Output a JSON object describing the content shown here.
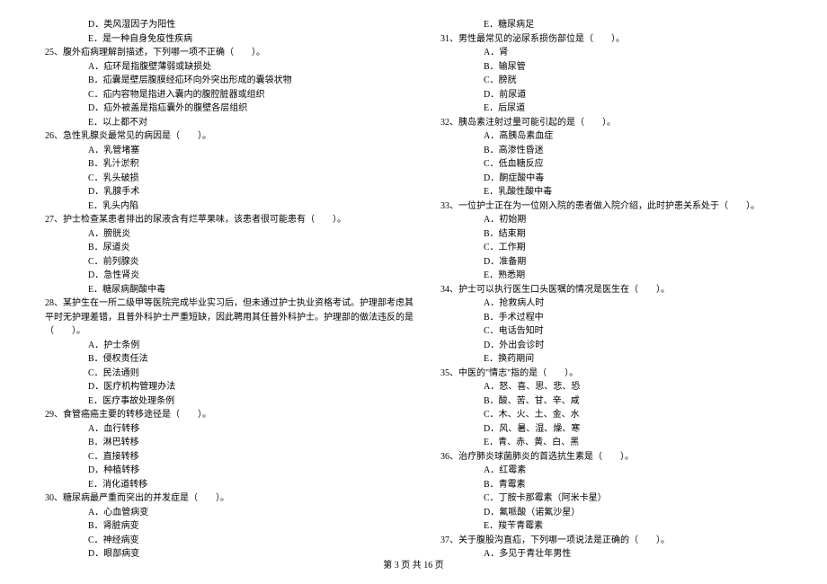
{
  "left_column": [
    {
      "cls": "option",
      "text": "D．类风湿因子为阳性"
    },
    {
      "cls": "option",
      "text": "E．是一种自身免疫性疾病"
    },
    {
      "cls": "question",
      "text": "25、腹外疝病理解剖描述，下列哪一项不正确（　　）。"
    },
    {
      "cls": "option",
      "text": "A．疝环是指腹壁薄弱或缺损处"
    },
    {
      "cls": "option",
      "text": "B．疝囊是壁层腹膜经疝环向外突出形成的囊袋状物"
    },
    {
      "cls": "option",
      "text": "C．疝内容物是指进入囊内的腹腔脏器或组织"
    },
    {
      "cls": "option",
      "text": "D．疝外被盖是指疝囊外的腹壁各层组织"
    },
    {
      "cls": "option",
      "text": "E．以上都不对"
    },
    {
      "cls": "question",
      "text": "26、急性乳腺炎最常见的病因是（　　）。"
    },
    {
      "cls": "option",
      "text": "A．乳管堵塞"
    },
    {
      "cls": "option",
      "text": "B．乳汁淤积"
    },
    {
      "cls": "option",
      "text": "C．乳头破损"
    },
    {
      "cls": "option",
      "text": "D．乳腺手术"
    },
    {
      "cls": "option",
      "text": "E．乳头内陷"
    },
    {
      "cls": "question",
      "text": "27、护士检查某患者排出的尿液含有烂苹果味，该患者很可能患有（　　）。"
    },
    {
      "cls": "option",
      "text": "A．膀胱炎"
    },
    {
      "cls": "option",
      "text": "B．尿道炎"
    },
    {
      "cls": "option",
      "text": "C．前列腺炎"
    },
    {
      "cls": "option",
      "text": "D．急性肾炎"
    },
    {
      "cls": "option",
      "text": "E．糖尿病酮酸中毒"
    },
    {
      "cls": "question",
      "text": "28、某护生在一所二级甲等医院完成毕业实习后，但未通过护士执业资格考试。护理部考虑其"
    },
    {
      "cls": "question-cont",
      "text": "平时无护理差错，且普外科护士严重短缺，因此聘用其任普外科护士。护理部的做法违反的是"
    },
    {
      "cls": "question-cont",
      "text": "（　　）。"
    },
    {
      "cls": "option",
      "text": "A．护士条例"
    },
    {
      "cls": "option",
      "text": "B．侵权责任法"
    },
    {
      "cls": "option",
      "text": "C．民法通则"
    },
    {
      "cls": "option",
      "text": "D．医疗机构管理办法"
    },
    {
      "cls": "option",
      "text": "E．医疗事故处理条例"
    },
    {
      "cls": "question",
      "text": "29、食管癌癌主要的转移途径是（　　）。"
    },
    {
      "cls": "option",
      "text": "A．血行转移"
    },
    {
      "cls": "option",
      "text": "B．淋巴转移"
    },
    {
      "cls": "option",
      "text": "C．直接转移"
    },
    {
      "cls": "option",
      "text": "D．种植转移"
    },
    {
      "cls": "option",
      "text": "E．消化道转移"
    },
    {
      "cls": "question",
      "text": "30、糖尿病最严重而突出的并发症是（　　）。"
    },
    {
      "cls": "option",
      "text": "A．心血管病变"
    },
    {
      "cls": "option",
      "text": "B．肾脏病变"
    },
    {
      "cls": "option",
      "text": "C．神经病变"
    },
    {
      "cls": "option",
      "text": "D．眼部病变"
    }
  ],
  "right_column": [
    {
      "cls": "option",
      "text": "E．糖尿病足"
    },
    {
      "cls": "question",
      "text": "31、男性最常见的泌尿系损伤部位是（　　）。"
    },
    {
      "cls": "option",
      "text": "A．肾"
    },
    {
      "cls": "option",
      "text": "B．输尿管"
    },
    {
      "cls": "option",
      "text": "C．膀胱"
    },
    {
      "cls": "option",
      "text": "D．前尿道"
    },
    {
      "cls": "option",
      "text": "E．后尿道"
    },
    {
      "cls": "question",
      "text": "32、胰岛素注射过量可能引起的是（　　）。"
    },
    {
      "cls": "option",
      "text": "A．高胰岛素血症"
    },
    {
      "cls": "option",
      "text": "B．高渗性昏迷"
    },
    {
      "cls": "option",
      "text": "C．低血糖反应"
    },
    {
      "cls": "option",
      "text": "D．酮症酸中毒"
    },
    {
      "cls": "option",
      "text": "E．乳酸性酸中毒"
    },
    {
      "cls": "question",
      "text": "33、一位护士正在为一位刚入院的患者做入院介绍，此时护患关系处于（　　）。"
    },
    {
      "cls": "option",
      "text": "A．初始期"
    },
    {
      "cls": "option",
      "text": "B．结束期"
    },
    {
      "cls": "option",
      "text": "C．工作期"
    },
    {
      "cls": "option",
      "text": "D．准备期"
    },
    {
      "cls": "option",
      "text": "E．熟悉期"
    },
    {
      "cls": "question",
      "text": "34、护士可以执行医生口头医嘱的情况是医生在（　　）。"
    },
    {
      "cls": "option",
      "text": "A．抢救病人时"
    },
    {
      "cls": "option",
      "text": "B．手术过程中"
    },
    {
      "cls": "option",
      "text": "C．电话告知时"
    },
    {
      "cls": "option",
      "text": "D．外出会诊时"
    },
    {
      "cls": "option",
      "text": "E．换药期间"
    },
    {
      "cls": "question",
      "text": "35、中医的\"情志\"指的是（　　）。"
    },
    {
      "cls": "option",
      "text": "A．怒、喜、思、悲、恐"
    },
    {
      "cls": "option",
      "text": "B．酸、苦、甘、辛、咸"
    },
    {
      "cls": "option",
      "text": "C．木、火、土、金、水"
    },
    {
      "cls": "option",
      "text": "D．风、暑、湿、燥、寒"
    },
    {
      "cls": "option",
      "text": "E．青、赤、黄、白、黑"
    },
    {
      "cls": "question",
      "text": "36、治疗肺炎球菌肺炎的首选抗生素是（　　）。"
    },
    {
      "cls": "option",
      "text": "A．红霉素"
    },
    {
      "cls": "option",
      "text": "B．青霉素"
    },
    {
      "cls": "option",
      "text": "C．丁胺卡那霉素（阿米卡星）"
    },
    {
      "cls": "option",
      "text": "D．氟哌酸（诺氟沙星）"
    },
    {
      "cls": "option",
      "text": "E．羧苄青霉素"
    },
    {
      "cls": "question",
      "text": "37、关于腹股沟直疝，下列哪一项说法是正确的（　　）。"
    },
    {
      "cls": "option",
      "text": "A．多见于青壮年男性"
    }
  ],
  "footer": "第 3 页 共 16 页"
}
